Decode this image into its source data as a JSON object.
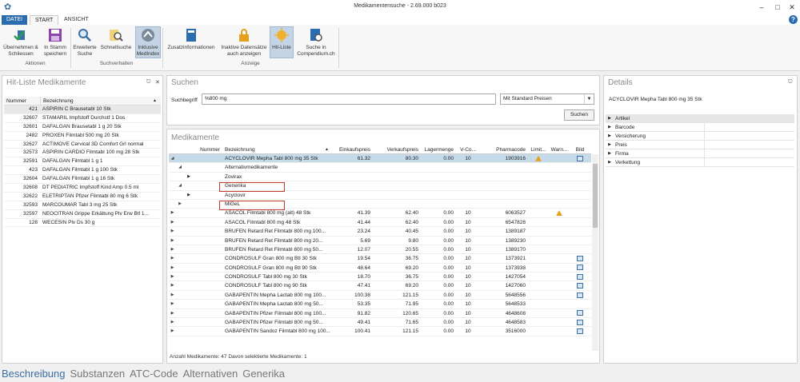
{
  "window": {
    "title": "Medikamentensuche - 2.69.000 b023"
  },
  "tabs": {
    "file": "DATEI",
    "start": "START",
    "view": "ANSICHT"
  },
  "ribbon": {
    "buttons": [
      {
        "label1": "Übernehmen &",
        "label2": "Schliessen"
      },
      {
        "label1": "In Stamm",
        "label2": "speichern"
      },
      {
        "label1": "Erweiterte",
        "label2": "Suche"
      },
      {
        "label1": "Schnellsuche",
        "label2": ""
      },
      {
        "label1": "Inklusive",
        "label2": "MedIndex"
      },
      {
        "label1": "Zusatzinformationen",
        "label2": ""
      },
      {
        "label1": "Inaktive Datensätze",
        "label2": "auch anzeigen"
      },
      {
        "label1": "Hit-Liste",
        "label2": ""
      },
      {
        "label1": "Suche in",
        "label2": "Compendium.ch"
      }
    ],
    "groups": {
      "aktionen": "Aktionen",
      "suchverhalten": "Suchverhalten",
      "anzeige": "Anzeige"
    }
  },
  "hitlist": {
    "title": "Hit-Liste Medikamente",
    "col_num": "Nummer",
    "col_bez": "Bezeichnung",
    "rows": [
      {
        "num": "421",
        "bez": "ASPIRIN C Brausetabl 10 Stk"
      },
      {
        "num": "32607",
        "bez": "STAMARIL Impfstoff Durchstf 1 Dos"
      },
      {
        "num": "32601",
        "bez": "DAFALGAN Brausetabl 1 g 20 Stk"
      },
      {
        "num": "2482",
        "bez": "PROXEN Filmtabl 500 mg 20 Stk"
      },
      {
        "num": "32627",
        "bez": "ACTIMOVE Cervical 3D Comfort Grl normal"
      },
      {
        "num": "32573",
        "bez": "ASPIRIN CARDIO Filmtabl 100 mg 28 Stk"
      },
      {
        "num": "32591",
        "bez": "DAFALGAN Filmtabl 1 g 1"
      },
      {
        "num": "423",
        "bez": "DAFALGAN Filmtabl 1 g 100 Stk"
      },
      {
        "num": "32604",
        "bez": "DAFALGAN Filmtabl 1 g 16 Stk"
      },
      {
        "num": "32608",
        "bez": "DT PEDIATRIC Impfstoff Kind Amp 0.5 ml"
      },
      {
        "num": "32622",
        "bez": "ELETRIPTAN Pfizer Filmtabl 80 mg 6 Stk"
      },
      {
        "num": "32593",
        "bez": "MARCOUMAR Tabl 3 mg 25 Stk"
      },
      {
        "num": "32597",
        "bez": "NEOCITRAN Grippe Erkältung Plv Erw Btl 1..."
      },
      {
        "num": "128",
        "bez": "WECESIN Plv Ds 30 g"
      }
    ]
  },
  "search": {
    "title": "Suchen",
    "label": "Suchbegriff",
    "value": "%800 mg",
    "price_option": "Mit Standard Preisen",
    "button": "Suchen"
  },
  "meds": {
    "title": "Medikamente",
    "headers": {
      "num": "Nummer",
      "bez": "Bezeichnung",
      "ek": "Einkaufspreis",
      "vk": "Verkaufspreis",
      "lm": "Lagermenge",
      "vc": "V-Co...",
      "pc": "Pharmacode",
      "lim": "Limit...",
      "warn": "Warn...",
      "bild": "Bild"
    },
    "selected": {
      "bez": "ACYCLOVIR Mepha Tabl 800 mg 35 Stk",
      "ek": "61.32",
      "vk": "80.30",
      "lm": "0.00",
      "vc": "10",
      "pc": "1903916"
    },
    "sub": [
      "Alternativmedikamente",
      "Zovirax",
      "Generika",
      "Acyclovir",
      "MiGeL"
    ],
    "rows": [
      {
        "bez": "ASACOL Filmtabl 800 mg (alt) 48 Stk",
        "ek": "41.39",
        "vk": "62.40",
        "lm": "0.00",
        "vc": "10",
        "pc": "6063527",
        "warn": true,
        "bild": false
      },
      {
        "bez": "ASACOL Filmtabl 800 mg 48 Stk",
        "ek": "41.44",
        "vk": "62.40",
        "lm": "0.00",
        "vc": "10",
        "pc": "6547828",
        "warn": false,
        "bild": false
      },
      {
        "bez": "BRUFEN Retard Ret Filmtabl 800 mg 100...",
        "ek": "23.24",
        "vk": "40.45",
        "lm": "0.00",
        "vc": "10",
        "pc": "1389187",
        "warn": false,
        "bild": false
      },
      {
        "bez": "BRUFEN Retard Ret Filmtabl 800 mg 20...",
        "ek": "5.69",
        "vk": "9.80",
        "lm": "0.00",
        "vc": "10",
        "pc": "1389230",
        "warn": false,
        "bild": false
      },
      {
        "bez": "BRUFEN Retard Ret Filmtabl 800 mg 50...",
        "ek": "12.07",
        "vk": "20.55",
        "lm": "0.00",
        "vc": "10",
        "pc": "1389170",
        "warn": false,
        "bild": false
      },
      {
        "bez": "CONDROSULF Gran 800 mg Btl 30 Stk",
        "ek": "19.54",
        "vk": "36.75",
        "lm": "0.00",
        "vc": "10",
        "pc": "1373921",
        "warn": false,
        "bild": true
      },
      {
        "bez": "CONDROSULF Gran 800 mg Btl 90 Stk",
        "ek": "48.64",
        "vk": "69.20",
        "lm": "0.00",
        "vc": "10",
        "pc": "1373938",
        "warn": false,
        "bild": true
      },
      {
        "bez": "CONDROSULF Tabl 800 mg 30 Stk",
        "ek": "18.70",
        "vk": "36.75",
        "lm": "0.00",
        "vc": "10",
        "pc": "1427054",
        "warn": false,
        "bild": true
      },
      {
        "bez": "CONDROSULF Tabl 800 mg 90 Stk",
        "ek": "47.41",
        "vk": "69.20",
        "lm": "0.00",
        "vc": "10",
        "pc": "1427060",
        "warn": false,
        "bild": true
      },
      {
        "bez": "GABAPENTIN Mepha Lactab 800 mg 100...",
        "ek": "100.38",
        "vk": "121.15",
        "lm": "0.00",
        "vc": "10",
        "pc": "5648556",
        "warn": false,
        "bild": true
      },
      {
        "bez": "GABAPENTIN Mepha Lactab 800 mg 50...",
        "ek": "53.35",
        "vk": "71.95",
        "lm": "0.00",
        "vc": "10",
        "pc": "5648533",
        "warn": false,
        "bild": false
      },
      {
        "bez": "GABAPENTIN Pfizer Filmtabl 800 mg 100...",
        "ek": "91.82",
        "vk": "120.65",
        "lm": "0.00",
        "vc": "10",
        "pc": "4648608",
        "warn": false,
        "bild": true
      },
      {
        "bez": "GABAPENTIN Pfizer Filmtabl 800 mg 50...",
        "ek": "49.41",
        "vk": "71.65",
        "lm": "0.00",
        "vc": "10",
        "pc": "4648583",
        "warn": false,
        "bild": true
      },
      {
        "bez": "GABAPENTIN Sandoz Filmtabl 800 mg 100...",
        "ek": "100.41",
        "vk": "121.15",
        "lm": "0.00",
        "vc": "10",
        "pc": "3516000",
        "warn": false,
        "bild": true
      }
    ],
    "status": "Anzahl Medikamente: 47   Davon selektierte Medikamente: 1"
  },
  "details": {
    "title": "Details",
    "name": "ACYCLOVIR Mepha Tabl 800 mg 35 Stk",
    "items": [
      "Artikel",
      "Barcode",
      "Versicherung",
      "Preis",
      "Firma",
      "Verkettung"
    ]
  },
  "bottom_tabs": [
    "Beschreibung",
    "Substanzen",
    "ATC-Code",
    "Alternativen",
    "Generika"
  ]
}
